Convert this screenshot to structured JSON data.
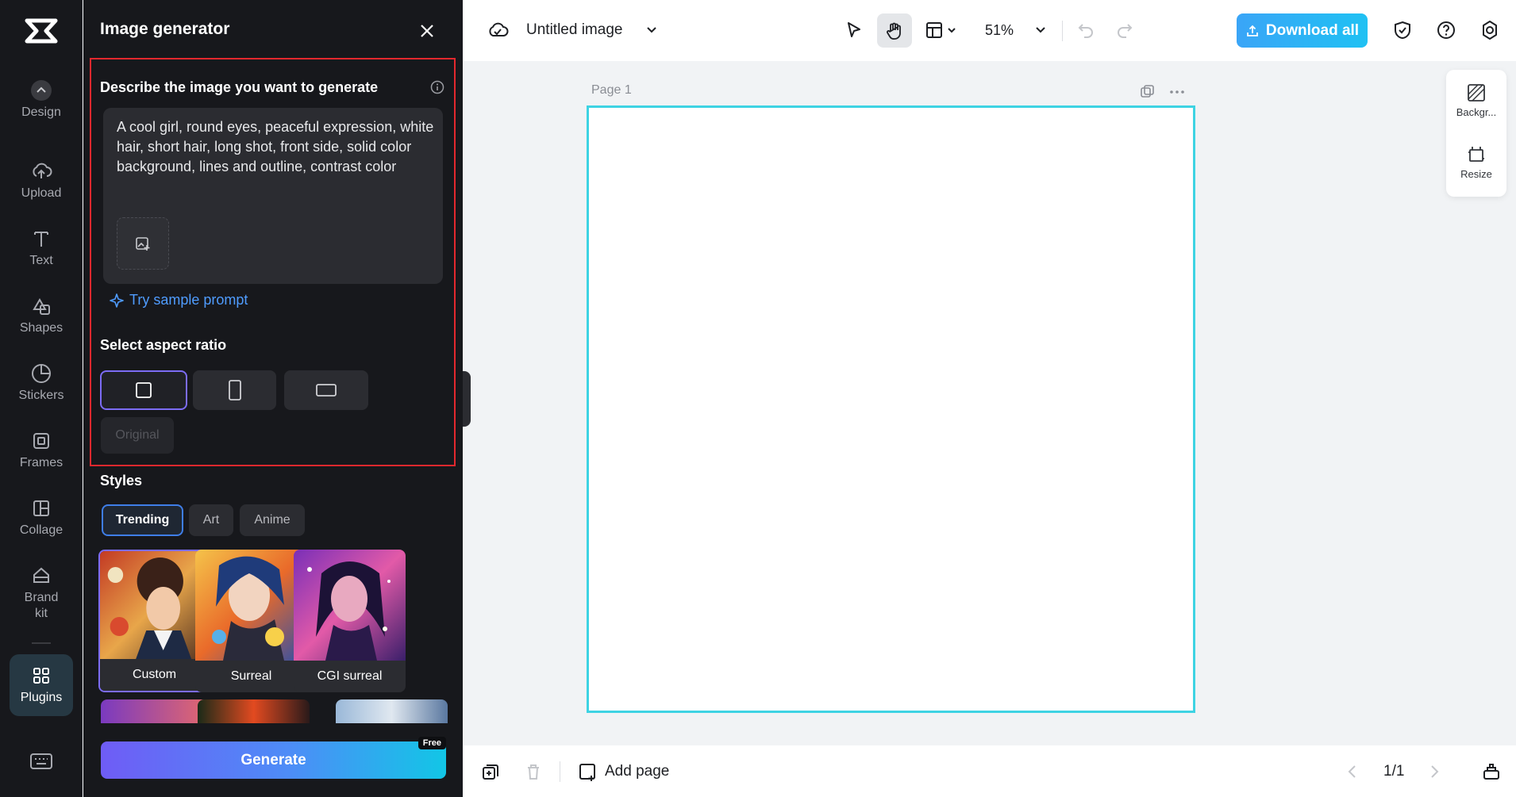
{
  "rail": {
    "items": [
      {
        "id": "design",
        "label": "Design",
        "icon": "design-icon"
      },
      {
        "id": "upload",
        "label": "Upload",
        "icon": "cloud-upload-icon"
      },
      {
        "id": "text",
        "label": "Text",
        "icon": "text-icon"
      },
      {
        "id": "shapes",
        "label": "Shapes",
        "icon": "shapes-icon"
      },
      {
        "id": "stickers",
        "label": "Stickers",
        "icon": "sticker-icon"
      },
      {
        "id": "frames",
        "label": "Frames",
        "icon": "frame-icon"
      },
      {
        "id": "collage",
        "label": "Collage",
        "icon": "collage-icon"
      },
      {
        "id": "brand",
        "label_line1": "Brand",
        "label_line2": "kit",
        "icon": "brand-kit-icon"
      },
      {
        "id": "plugins",
        "label": "Plugins",
        "icon": "grid-icon"
      }
    ]
  },
  "panel": {
    "title": "Image generator",
    "describe_label": "Describe the image you want to generate",
    "prompt_text": "A cool girl, round eyes, peaceful expression, white hair, short hair, long shot, front side, solid color background, lines and outline, contrast color",
    "sample_prompt": "Try sample prompt",
    "aspect_label": "Select aspect ratio",
    "original_label": "Original",
    "styles_label": "Styles",
    "style_tabs": [
      "Trending",
      "Art",
      "Anime"
    ],
    "style_cards": [
      "Custom",
      "Surreal",
      "CGI surreal"
    ],
    "generate_label": "Generate",
    "free_badge": "Free"
  },
  "topbar": {
    "doc_title": "Untitled image",
    "zoom": "51%",
    "download_label": "Download all"
  },
  "canvas": {
    "page_label": "Page 1"
  },
  "right_tools": {
    "background_label": "Backgr...",
    "resize_label": "Resize"
  },
  "bottombar": {
    "add_page_label": "Add page",
    "pager": "1/1"
  },
  "colors": {
    "accent": "#3ed3e3",
    "highlight": "#e3282e",
    "link": "#4f9cff",
    "selected_border": "#7c6cf4"
  }
}
